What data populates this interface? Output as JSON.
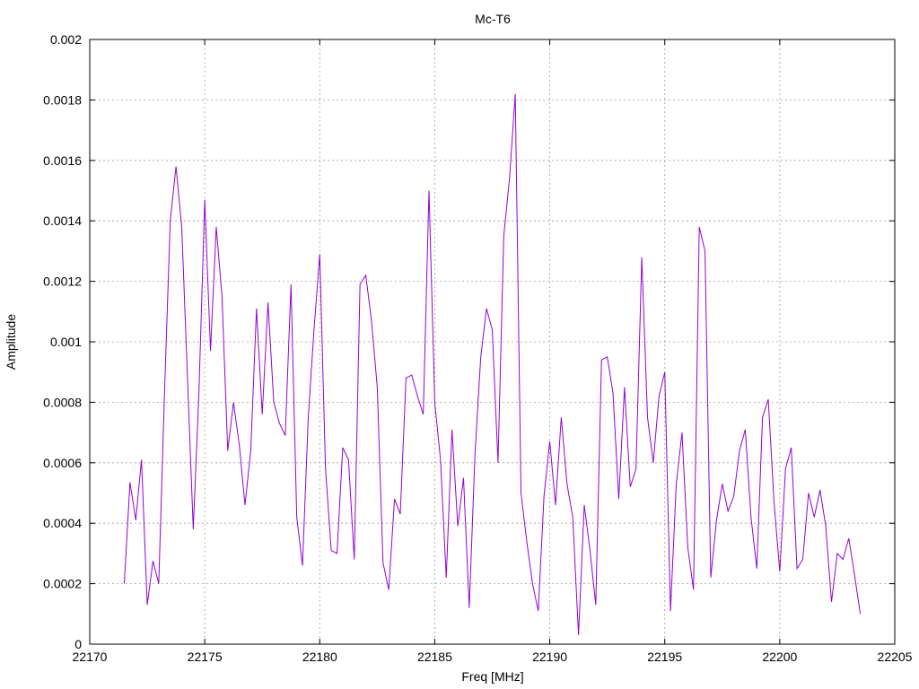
{
  "chart_data": {
    "type": "line",
    "title": "Mc-T6",
    "xlabel": "Freq [MHz]",
    "ylabel": "Amplitude",
    "xlim": [
      22170,
      22205
    ],
    "ylim": [
      0,
      0.002
    ],
    "x_ticks": [
      "22170",
      "22175",
      "22180",
      "22185",
      "22190",
      "22195",
      "22200",
      "22205"
    ],
    "y_ticks": [
      "0",
      "0.0002",
      "0.0004",
      "0.0006",
      "0.0008",
      "0.001",
      "0.0012",
      "0.0014",
      "0.0016",
      "0.0018",
      "0.002"
    ],
    "grid": true,
    "series": [
      {
        "color": "#9400d3",
        "x": [
          22171.5,
          22171.75,
          22172.0,
          22172.25,
          22172.5,
          22172.75,
          22173.0,
          22173.25,
          22173.5,
          22173.75,
          22174.0,
          22174.25,
          22174.5,
          22174.75,
          22175.0,
          22175.25,
          22175.5,
          22175.75,
          22176.0,
          22176.25,
          22176.5,
          22176.75,
          22177.0,
          22177.25,
          22177.5,
          22177.75,
          22178.0,
          22178.25,
          22178.5,
          22178.75,
          22179.0,
          22179.25,
          22179.5,
          22179.75,
          22180.0,
          22180.25,
          22180.5,
          22180.75,
          22181.0,
          22181.25,
          22181.5,
          22181.75,
          22182.0,
          22182.25,
          22182.5,
          22182.75,
          22183.0,
          22183.25,
          22183.5,
          22183.75,
          22184.0,
          22184.25,
          22184.5,
          22184.75,
          22185.0,
          22185.25,
          22185.5,
          22185.75,
          22186.0,
          22186.25,
          22186.5,
          22186.75,
          22187.0,
          22187.25,
          22187.5,
          22187.75,
          22188.0,
          22188.25,
          22188.5,
          22188.75,
          22189.0,
          22189.25,
          22189.5,
          22189.75,
          22190.0,
          22190.25,
          22190.5,
          22190.75,
          22191.0,
          22191.25,
          22191.5,
          22191.75,
          22192.0,
          22192.25,
          22192.5,
          22192.75,
          22193.0,
          22193.25,
          22193.5,
          22193.75,
          22194.0,
          22194.25,
          22194.5,
          22194.75,
          22195.0,
          22195.25,
          22195.5,
          22195.75,
          22196.0,
          22196.25,
          22196.5,
          22196.75,
          22197.0,
          22197.25,
          22197.5,
          22197.75,
          22198.0,
          22198.25,
          22198.5,
          22198.75,
          22199.0,
          22199.25,
          22199.5,
          22199.75,
          22200.0,
          22200.25,
          22200.5,
          22200.75,
          22201.0,
          22201.25,
          22201.5,
          22201.75,
          22202.0,
          22202.25,
          22202.5,
          22202.75,
          22203.0,
          22203.25,
          22203.5
        ],
        "y": [
          0.0002,
          0.000535,
          0.00041,
          0.00061,
          0.00013,
          0.000275,
          0.0002,
          0.00083,
          0.0014,
          0.00158,
          0.00138,
          0.00088,
          0.00038,
          0.00084,
          0.00147,
          0.00097,
          0.00138,
          0.00115,
          0.00064,
          0.0008,
          0.00066,
          0.00046,
          0.00064,
          0.00111,
          0.00076,
          0.00113,
          0.0008,
          0.00073,
          0.00069,
          0.00119,
          0.00042,
          0.00026,
          0.00075,
          0.00104,
          0.00129,
          0.00058,
          0.00031,
          0.0003,
          0.00065,
          0.00061,
          0.00028,
          0.00119,
          0.00122,
          0.00107,
          0.00085,
          0.00027,
          0.00018,
          0.00048,
          0.00043,
          0.00088,
          0.00089,
          0.00082,
          0.00076,
          0.0015,
          0.0008,
          0.00061,
          0.00022,
          0.00071,
          0.00039,
          0.00055,
          0.00012,
          0.00063,
          0.00095,
          0.00111,
          0.00104,
          0.0006,
          0.00135,
          0.00154,
          0.00182,
          0.0005,
          0.00034,
          0.0002,
          0.00011,
          0.00049,
          0.00067,
          0.00046,
          0.00075,
          0.00053,
          0.00042,
          3e-05,
          0.00046,
          0.00031,
          0.00013,
          0.00094,
          0.00095,
          0.00083,
          0.00048,
          0.00085,
          0.00052,
          0.00058,
          0.00128,
          0.00075,
          0.0006,
          0.00082,
          0.0009,
          0.00011,
          0.00053,
          0.0007,
          0.00032,
          0.00018,
          0.00138,
          0.0013,
          0.00022,
          0.00041,
          0.00053,
          0.00044,
          0.00049,
          0.00064,
          0.00071,
          0.00042,
          0.00025,
          0.00075,
          0.00081,
          0.00047,
          0.00024,
          0.00058,
          0.00065,
          0.00025,
          0.00028,
          0.0005,
          0.00042,
          0.00051,
          0.00039,
          0.00014,
          0.0003,
          0.00028,
          0.00035,
          0.00023,
          0.0001
        ]
      }
    ]
  }
}
